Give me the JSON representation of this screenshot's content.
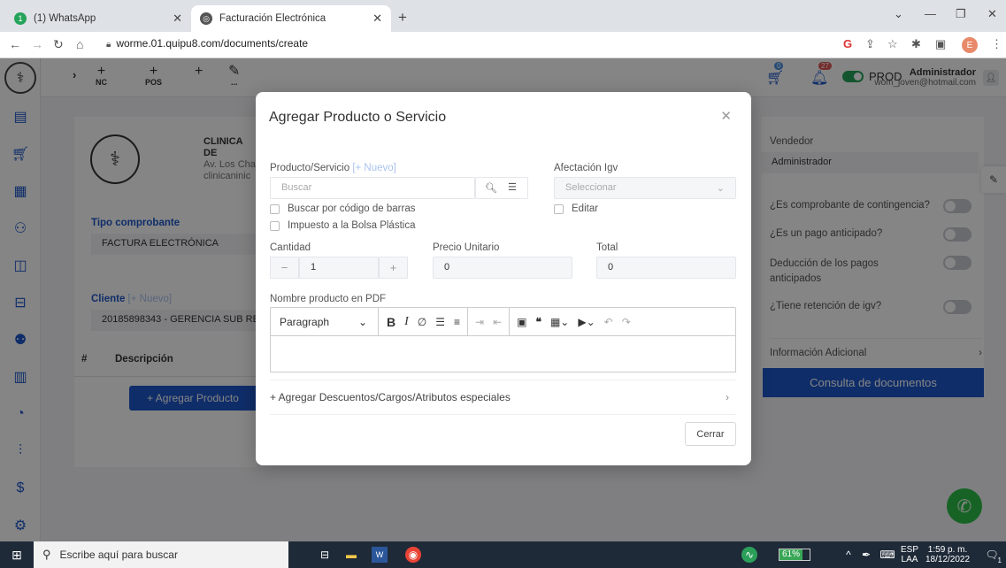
{
  "browser": {
    "tabs": [
      {
        "title": "(1) WhatsApp",
        "active": false
      },
      {
        "title": "Facturación Electrónica",
        "active": true
      }
    ],
    "new_tab": "+",
    "url": "worme.01.quipu8.com/documents/create",
    "profile_initial": "E"
  },
  "topbar": {
    "buttons": [
      {
        "icon": "plus",
        "label": "NC"
      },
      {
        "icon": "plus",
        "label": "POS"
      },
      {
        "icon": "plus",
        "label": ""
      },
      {
        "icon": "pencil",
        "label": "..."
      }
    ],
    "env_label": "PROD",
    "cart_badge": "0",
    "notif_badge": "27",
    "user_name": "Administrador",
    "user_email": "wom_joven@hotmail.com"
  },
  "sidebar": {
    "icons": [
      "document-icon",
      "cart-icon",
      "grid-icon",
      "user-check-icon",
      "bag-icon",
      "archive-icon",
      "users-icon",
      "book-icon",
      "pie-chart-icon",
      "bar-chart-icon",
      "dollar-icon",
      "settings-icon"
    ]
  },
  "background": {
    "company_name": "CLINICA DE",
    "company_addr": "Av. Los Cha",
    "company_email": "clinicaninic",
    "tipo_label": "Tipo comprobante",
    "tipo_value": "FACTURA ELECTRÓNICA",
    "cliente_label": "Cliente",
    "cliente_new": "[+ Nuevo]",
    "cliente_value": "20185898343 - GERENCIA SUB RE",
    "table_hash": "#",
    "table_desc": "Descripción",
    "add_product": "+ Agregar Producto",
    "vendedor_label": "Vendedor",
    "vendedor_value": "Administrador",
    "contingencia": "¿Es comprobante de contingencia?",
    "anticipado": "¿Es un pago anticipado?",
    "deduccion": "Deducción de los pagos anticipados",
    "retencion": "¿Tiene retención de igv?",
    "info_adicional": "Información Adicional",
    "consulta": "Consulta de documentos"
  },
  "modal": {
    "title": "Agregar Producto o Servicio",
    "producto_label": "Producto/Servicio",
    "producto_new": "[+ Nuevo]",
    "search_placeholder": "Buscar",
    "afectacion_label": "Afectación Igv",
    "afectacion_placeholder": "Seleccionar",
    "chk_barcode": "Buscar por código de barras",
    "chk_editar": "Editar",
    "chk_bolsa": "Impuesto a la Bolsa Plástica",
    "cantidad_label": "Cantidad",
    "cantidad_value": "1",
    "precio_label": "Precio Unitario",
    "precio_value": "0",
    "total_label": "Total",
    "total_value": "0",
    "nombre_pdf_label": "Nombre producto en PDF",
    "editor_format": "Paragraph",
    "extras_label": "+ Agregar Descuentos/Cargos/Atributos especiales",
    "close_button": "Cerrar"
  },
  "taskbar": {
    "search_placeholder": "Escribe aquí para buscar",
    "battery": "61%",
    "lang_top": "ESP",
    "lang_bottom": "LAA",
    "time": "1:59 p. m.",
    "date": "18/12/2022",
    "notif_count": "1"
  }
}
